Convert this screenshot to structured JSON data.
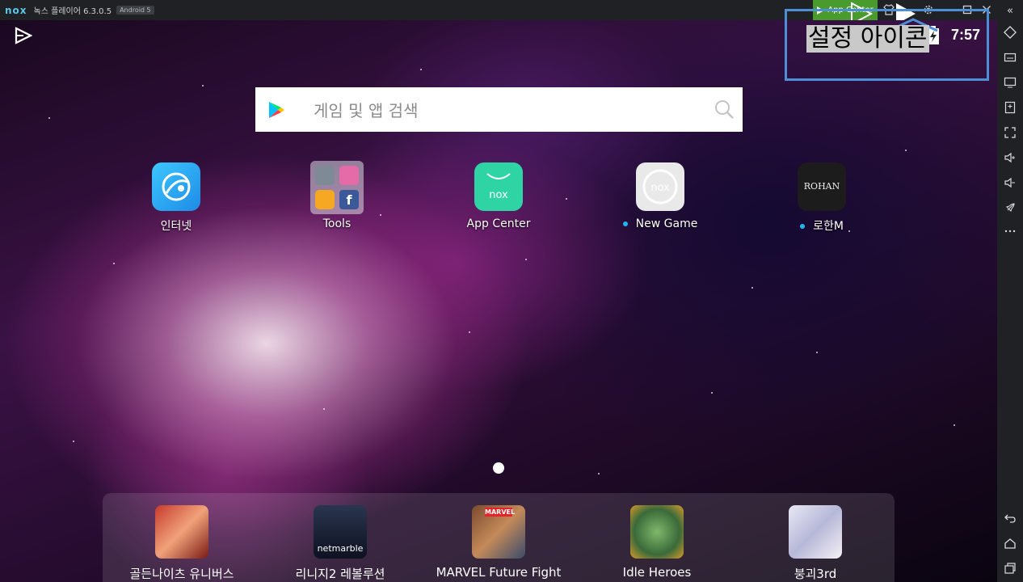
{
  "titlebar": {
    "logo": "nox",
    "title": "녹스 플레이어 6.3.0.5",
    "android_badge": "Android 5",
    "app_center": "App Center",
    "buttons": [
      "shirt-icon",
      "user-icon",
      "gear-icon",
      "minimize-icon",
      "maximize-icon",
      "close-icon"
    ]
  },
  "statusbar": {
    "time": "7:57",
    "icons": [
      "wifi-icon",
      "signal-icon",
      "battery-charging-icon"
    ]
  },
  "annotation": {
    "label": "설정 아이콘"
  },
  "search": {
    "placeholder": "게임 및 앱 검색"
  },
  "home_apps": [
    {
      "label": "인터넷",
      "icon": "internet-icon",
      "new": false
    },
    {
      "label": "Tools",
      "icon": "tools-folder-icon",
      "new": false
    },
    {
      "label": "App Center",
      "icon": "app-center-icon",
      "new": false
    },
    {
      "label": "New Game",
      "icon": "new-game-icon",
      "new": true
    },
    {
      "label": "로한M",
      "icon": "rohan-icon",
      "new": true
    }
  ],
  "dock_apps": [
    {
      "label": "골든나이츠 유니버스",
      "icon": "golden-knights-icon"
    },
    {
      "label": "리니지2 레볼루션",
      "icon": "lineage2-icon"
    },
    {
      "label": "MARVEL Future Fight",
      "icon": "marvel-future-fight-icon"
    },
    {
      "label": "Idle Heroes",
      "icon": "idle-heroes-icon"
    },
    {
      "label": "붕괴3rd",
      "icon": "honkai-icon"
    }
  ],
  "sidebar": {
    "collapse": "«",
    "buttons": [
      "rotate-icon",
      "keyboard-icon",
      "screen-icon",
      "fps-icon",
      "fullscreen-icon",
      "volume-up-icon",
      "volume-down-icon",
      "rocket-icon",
      "more-icon"
    ],
    "bottom_buttons": [
      "back-icon",
      "home-icon",
      "recents-icon"
    ]
  },
  "colors": {
    "app_center_green": "#4a9b2e",
    "annotation_blue": "#4d8fd6",
    "new_dot": "#22b8ef"
  }
}
